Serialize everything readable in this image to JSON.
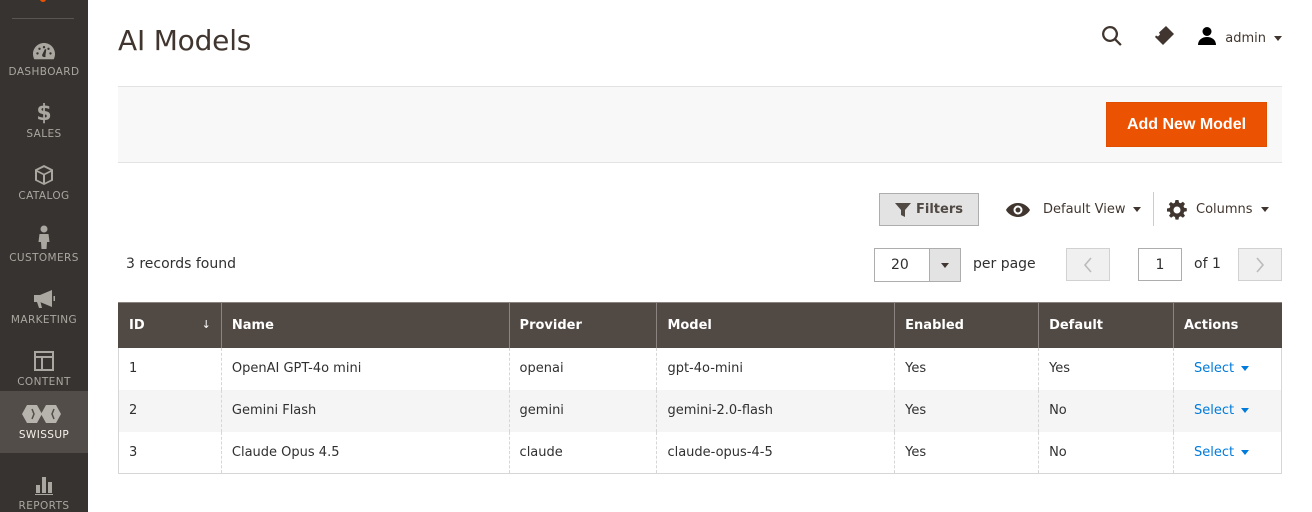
{
  "sidebar": {
    "items": [
      {
        "label": "DASHBOARD",
        "icon": "dashboard-icon"
      },
      {
        "label": "SALES",
        "icon": "dollar-icon"
      },
      {
        "label": "CATALOG",
        "icon": "box-icon"
      },
      {
        "label": "CUSTOMERS",
        "icon": "person-icon"
      },
      {
        "label": "MARKETING",
        "icon": "megaphone-icon"
      },
      {
        "label": "CONTENT",
        "icon": "layout-icon"
      },
      {
        "label": "SWISSUP",
        "icon": "swissup-icon"
      },
      {
        "label": "REPORTS",
        "icon": "bar-chart-icon"
      }
    ],
    "active": "SWISSUP"
  },
  "header": {
    "title": "AI Models",
    "user": "admin"
  },
  "actions": {
    "add_label": "Add New Model"
  },
  "toolbar": {
    "filters_label": "Filters",
    "view_label": "Default View",
    "columns_label": "Columns"
  },
  "pager": {
    "records_text": "3 records found",
    "per_page_value": "20",
    "per_page_label": "per page",
    "page": "1",
    "of_text": "of 1"
  },
  "table": {
    "columns": [
      "ID",
      "Name",
      "Provider",
      "Model",
      "Enabled",
      "Default",
      "Actions"
    ],
    "sort_indicator": "↓",
    "rows": [
      {
        "id": "1",
        "name": "OpenAI GPT-4o mini",
        "provider": "openai",
        "model": "gpt-4o-mini",
        "enabled": "Yes",
        "default": "Yes",
        "action": "Select"
      },
      {
        "id": "2",
        "name": "Gemini Flash",
        "provider": "gemini",
        "model": "gemini-2.0-flash",
        "enabled": "Yes",
        "default": "No",
        "action": "Select"
      },
      {
        "id": "3",
        "name": "Claude Opus 4.5",
        "provider": "claude",
        "model": "claude-opus-4-5",
        "enabled": "Yes",
        "default": "No",
        "action": "Select"
      }
    ]
  },
  "colors": {
    "accent": "#eb5202",
    "sidebar_bg": "#373330",
    "table_header_bg": "#514943",
    "link": "#007bdb"
  }
}
